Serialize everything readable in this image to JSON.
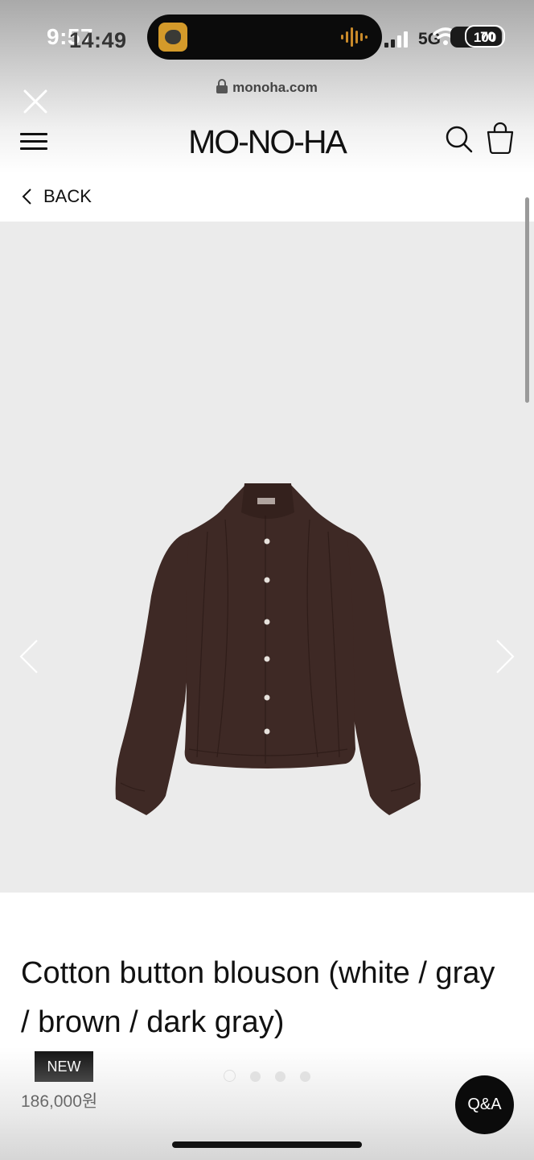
{
  "status_bar": {
    "time": "9:57",
    "time_overlay": "14:49",
    "network": "5G",
    "battery": "100",
    "battery_overlay": "70"
  },
  "browser": {
    "url": "monoha.com"
  },
  "header": {
    "brand": "MO-NO-HA"
  },
  "nav": {
    "back_label": "BACK"
  },
  "product": {
    "title": "Cotton button blouson (white / gray / brown / dark gray)",
    "badge": "NEW",
    "price": "186,000원",
    "image_name": "brown cotton button blouson",
    "image_color": "#3e2925"
  },
  "gallery": {
    "slide_count": 4,
    "active_slide": 1
  },
  "floating": {
    "qa_label": "Q&A"
  },
  "icons": {
    "close": "close-icon",
    "lock": "lock-icon",
    "menu": "hamburger-icon",
    "search": "search-icon",
    "bag": "shopping-bag-icon",
    "back": "chevron-left-icon",
    "prev": "chevron-left-icon",
    "next": "chevron-right-icon"
  }
}
